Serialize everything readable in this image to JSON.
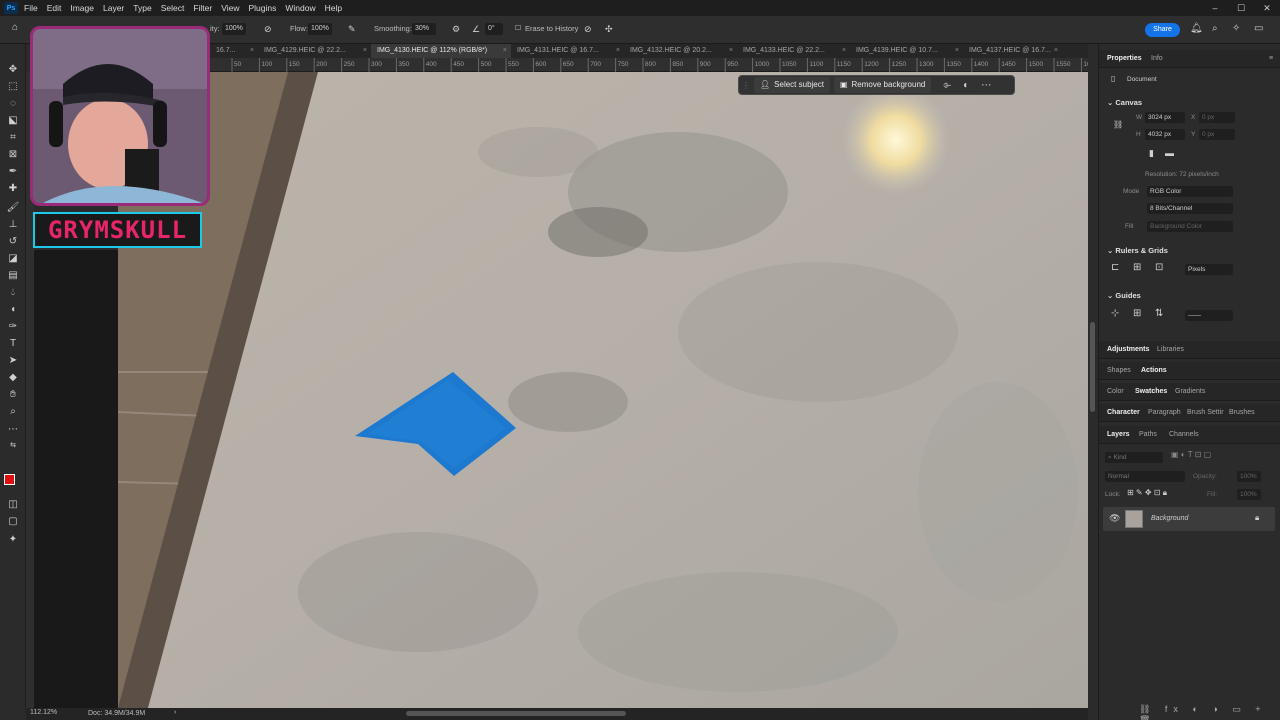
{
  "app": {
    "logo": "Ps"
  },
  "menu": [
    "File",
    "Edit",
    "Image",
    "Layer",
    "Type",
    "Select",
    "Filter",
    "View",
    "Plugins",
    "Window",
    "Help"
  ],
  "window_controls": {
    "minimize": "–",
    "maximize": "☐",
    "close": "✕"
  },
  "options": {
    "opacity_label": "ity:",
    "opacity_value": "100%",
    "flow_label": "Flow:",
    "flow_value": "100%",
    "smoothing_label": "Smoothing:",
    "smoothing_value": "30%",
    "angle_value": "0°",
    "erase_history": "Erase to History"
  },
  "share_label": "Share",
  "tabs": [
    {
      "label": "16.7...",
      "active": false
    },
    {
      "label": "IMG_4129.HEIC @ 22.2...",
      "active": false
    },
    {
      "label": "IMG_4130.HEIC @ 112% (RGB/8*)",
      "active": true
    },
    {
      "label": "IMG_4131.HEIC @ 16.7...",
      "active": false
    },
    {
      "label": "IMG_4132.HEIC @ 20.2...",
      "active": false
    },
    {
      "label": "IMG_4133.HEIC @ 22.2...",
      "active": false
    },
    {
      "label": "IMG_4139.HEIC @ 10.7...",
      "active": false
    },
    {
      "label": "IMG_4137.HEIC @ 16.7...",
      "active": false
    }
  ],
  "ruler": [
    "50",
    "100",
    "150",
    "200",
    "250",
    "300",
    "350",
    "400",
    "450",
    "500",
    "550",
    "600",
    "650",
    "700",
    "750",
    "800",
    "850",
    "900",
    "950",
    "1000",
    "1050",
    "1100",
    "1150",
    "1200",
    "1250",
    "1300",
    "1350",
    "1400",
    "1450",
    "1500",
    "1550",
    "1600",
    "1650"
  ],
  "brand": "GRYMSKULL",
  "taskbar": {
    "select_subject": "Select subject",
    "remove_background": "Remove background"
  },
  "status": {
    "zoom": "112.12%",
    "doc": "Doc: 34.9M/34.9M"
  },
  "properties": {
    "tabs": [
      "Properties",
      "Info"
    ],
    "document_label": "Document",
    "canvas_section": "Canvas",
    "w_label": "W",
    "w_value": "3024 px",
    "h_label": "H",
    "h_value": "4032 px",
    "x_label": "X",
    "x_value": "0 px",
    "y_label": "Y",
    "y_value": "0 px",
    "resolution": "Resolution: 72 pixels/inch",
    "mode_label": "Mode",
    "mode_value": "RGB Color",
    "bits_value": "8 Bits/Channel",
    "fill_label": "Fill",
    "fill_value": "Background Color",
    "rulers_section": "Rulers & Grids",
    "units_value": "Pixels",
    "guides_section": "Guides"
  },
  "panel_groups": {
    "group1": [
      "Adjustments",
      "Libraries"
    ],
    "group2": [
      "Shapes",
      "Actions"
    ],
    "group3": [
      "Color",
      "Swatches",
      "Gradients"
    ],
    "group4": [
      "Character",
      "Paragraph",
      "Brush Settir",
      "Brushes"
    ],
    "group5": [
      "Layers",
      "Paths",
      "Channels"
    ]
  },
  "layers": {
    "kind_placeholder": "Kind",
    "blend_mode": "Normal",
    "opacity_label": "Opacity:",
    "opacity_value": "100%",
    "lock_label": "Lock:",
    "fill_label": "Fill:",
    "fill_value": "100%",
    "layer_name": "Background"
  },
  "colors": {
    "accent": "#1473e6",
    "foreground_swatch": "#e01010",
    "patch_blue": "#1c79cf",
    "brand_pink": "#e8256a",
    "brand_border": "#1ec8e8"
  }
}
